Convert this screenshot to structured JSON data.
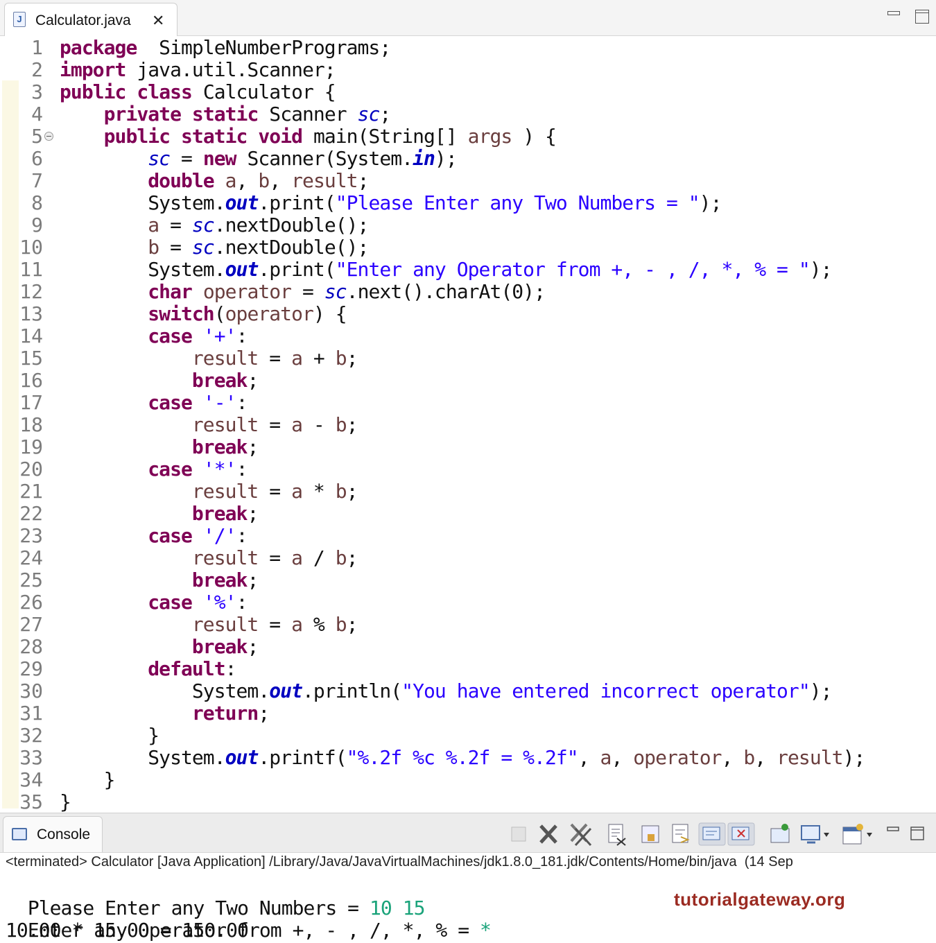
{
  "editor": {
    "tab_title": "Calculator.java",
    "tab_close": "✕"
  },
  "console": {
    "tab_title": "Console",
    "status": "<terminated> Calculator [Java Application] /Library/Java/JavaVirtualMachines/jdk1.8.0_181.jdk/Contents/Home/bin/java  (14 Sep",
    "output": {
      "line1_prompt": "Please Enter any Two Numbers = ",
      "line1_input": "10 15",
      "line2_prompt": "Enter any Operator from +, - , /, *, % = ",
      "line2_input": "*",
      "line3": "10.00 * 15.00 = 150.00"
    }
  },
  "watermark": "tutorialgateway.org",
  "lines": [
    {
      "n": "1",
      "tokens": [
        [
          "k",
          "package"
        ],
        [
          "",
          "  SimpleNumberPrograms;"
        ]
      ]
    },
    {
      "n": "2",
      "tokens": [
        [
          "k",
          "import"
        ],
        [
          "",
          " java.util.Scanner;"
        ]
      ]
    },
    {
      "n": "3",
      "tokens": [
        [
          "k",
          "public"
        ],
        [
          "",
          " "
        ],
        [
          "k",
          "class"
        ],
        [
          "",
          " Calculator {"
        ]
      ]
    },
    {
      "n": "4",
      "tokens": [
        [
          "",
          "    "
        ],
        [
          "k",
          "private"
        ],
        [
          "",
          " "
        ],
        [
          "k",
          "static"
        ],
        [
          "",
          " Scanner "
        ],
        [
          "f",
          "sc"
        ],
        [
          "",
          ";"
        ]
      ]
    },
    {
      "n": "5",
      "fold": true,
      "tokens": [
        [
          "",
          "    "
        ],
        [
          "k",
          "public"
        ],
        [
          "",
          " "
        ],
        [
          "k",
          "static"
        ],
        [
          "",
          " "
        ],
        [
          "k",
          "void"
        ],
        [
          "",
          " main(String[] "
        ],
        [
          "v",
          "args"
        ],
        [
          "",
          " ) {"
        ]
      ]
    },
    {
      "n": "6",
      "tokens": [
        [
          "",
          "        "
        ],
        [
          "f",
          "sc"
        ],
        [
          "",
          " = "
        ],
        [
          "k",
          "new"
        ],
        [
          "",
          " Scanner(System."
        ],
        [
          "sf",
          "in"
        ],
        [
          "",
          ");"
        ]
      ]
    },
    {
      "n": "7",
      "tokens": [
        [
          "",
          "        "
        ],
        [
          "k",
          "double"
        ],
        [
          "",
          " "
        ],
        [
          "v",
          "a"
        ],
        [
          "",
          ", "
        ],
        [
          "v",
          "b"
        ],
        [
          "",
          ", "
        ],
        [
          "v",
          "result"
        ],
        [
          "",
          ";"
        ]
      ]
    },
    {
      "n": "8",
      "tokens": [
        [
          "",
          "        System."
        ],
        [
          "sf",
          "out"
        ],
        [
          "",
          ".print("
        ],
        [
          "s",
          "\"Please Enter any Two Numbers = \""
        ],
        [
          "",
          ");"
        ]
      ]
    },
    {
      "n": "9",
      "tokens": [
        [
          "",
          "        "
        ],
        [
          "v",
          "a"
        ],
        [
          "",
          " = "
        ],
        [
          "f",
          "sc"
        ],
        [
          "",
          ".nextDouble();"
        ]
      ]
    },
    {
      "n": "10",
      "tokens": [
        [
          "",
          "        "
        ],
        [
          "v",
          "b"
        ],
        [
          "",
          " = "
        ],
        [
          "f",
          "sc"
        ],
        [
          "",
          ".nextDouble();"
        ]
      ]
    },
    {
      "n": "11",
      "tokens": [
        [
          "",
          "        System."
        ],
        [
          "sf",
          "out"
        ],
        [
          "",
          ".print("
        ],
        [
          "s",
          "\"Enter any Operator from +, - , /, *, % = \""
        ],
        [
          "",
          ");"
        ]
      ]
    },
    {
      "n": "12",
      "tokens": [
        [
          "",
          "        "
        ],
        [
          "k",
          "char"
        ],
        [
          "",
          " "
        ],
        [
          "v",
          "operator"
        ],
        [
          "",
          " = "
        ],
        [
          "f",
          "sc"
        ],
        [
          "",
          ".next().charAt(0);"
        ]
      ]
    },
    {
      "n": "13",
      "tokens": [
        [
          "",
          "        "
        ],
        [
          "k",
          "switch"
        ],
        [
          "",
          "("
        ],
        [
          "v",
          "operator"
        ],
        [
          "",
          ") {"
        ]
      ]
    },
    {
      "n": "14",
      "tokens": [
        [
          "",
          "        "
        ],
        [
          "k",
          "case"
        ],
        [
          "",
          " "
        ],
        [
          "s",
          "'+'"
        ],
        [
          "",
          ":"
        ]
      ]
    },
    {
      "n": "15",
      "tokens": [
        [
          "",
          "            "
        ],
        [
          "v",
          "result"
        ],
        [
          "",
          " = "
        ],
        [
          "v",
          "a"
        ],
        [
          "",
          " + "
        ],
        [
          "v",
          "b"
        ],
        [
          "",
          ";"
        ]
      ]
    },
    {
      "n": "16",
      "tokens": [
        [
          "",
          "            "
        ],
        [
          "k",
          "break"
        ],
        [
          "",
          ";"
        ]
      ]
    },
    {
      "n": "17",
      "tokens": [
        [
          "",
          "        "
        ],
        [
          "k",
          "case"
        ],
        [
          "",
          " "
        ],
        [
          "s",
          "'-'"
        ],
        [
          "",
          ":"
        ]
      ]
    },
    {
      "n": "18",
      "tokens": [
        [
          "",
          "            "
        ],
        [
          "v",
          "result"
        ],
        [
          "",
          " = "
        ],
        [
          "v",
          "a"
        ],
        [
          "",
          " - "
        ],
        [
          "v",
          "b"
        ],
        [
          "",
          ";"
        ]
      ]
    },
    {
      "n": "19",
      "tokens": [
        [
          "",
          "            "
        ],
        [
          "k",
          "break"
        ],
        [
          "",
          ";"
        ]
      ]
    },
    {
      "n": "20",
      "tokens": [
        [
          "",
          "        "
        ],
        [
          "k",
          "case"
        ],
        [
          "",
          " "
        ],
        [
          "s",
          "'*'"
        ],
        [
          "",
          ":"
        ]
      ]
    },
    {
      "n": "21",
      "tokens": [
        [
          "",
          "            "
        ],
        [
          "v",
          "result"
        ],
        [
          "",
          " = "
        ],
        [
          "v",
          "a"
        ],
        [
          "",
          " * "
        ],
        [
          "v",
          "b"
        ],
        [
          "",
          ";"
        ]
      ]
    },
    {
      "n": "22",
      "tokens": [
        [
          "",
          "            "
        ],
        [
          "k",
          "break"
        ],
        [
          "",
          ";"
        ]
      ]
    },
    {
      "n": "23",
      "tokens": [
        [
          "",
          "        "
        ],
        [
          "k",
          "case"
        ],
        [
          "",
          " "
        ],
        [
          "s",
          "'/'"
        ],
        [
          "",
          ":"
        ]
      ]
    },
    {
      "n": "24",
      "tokens": [
        [
          "",
          "            "
        ],
        [
          "v",
          "result"
        ],
        [
          "",
          " = "
        ],
        [
          "v",
          "a"
        ],
        [
          "",
          " / "
        ],
        [
          "v",
          "b"
        ],
        [
          "",
          ";"
        ]
      ]
    },
    {
      "n": "25",
      "tokens": [
        [
          "",
          "            "
        ],
        [
          "k",
          "break"
        ],
        [
          "",
          ";"
        ]
      ]
    },
    {
      "n": "26",
      "tokens": [
        [
          "",
          "        "
        ],
        [
          "k",
          "case"
        ],
        [
          "",
          " "
        ],
        [
          "s",
          "'%'"
        ],
        [
          "",
          ":"
        ]
      ]
    },
    {
      "n": "27",
      "tokens": [
        [
          "",
          "            "
        ],
        [
          "v",
          "result"
        ],
        [
          "",
          " = "
        ],
        [
          "v",
          "a"
        ],
        [
          "",
          " % "
        ],
        [
          "v",
          "b"
        ],
        [
          "",
          ";"
        ]
      ]
    },
    {
      "n": "28",
      "tokens": [
        [
          "",
          "            "
        ],
        [
          "k",
          "break"
        ],
        [
          "",
          ";"
        ]
      ]
    },
    {
      "n": "29",
      "tokens": [
        [
          "",
          "        "
        ],
        [
          "k",
          "default"
        ],
        [
          "",
          ":"
        ]
      ]
    },
    {
      "n": "30",
      "tokens": [
        [
          "",
          "            System."
        ],
        [
          "sf",
          "out"
        ],
        [
          "",
          ".println("
        ],
        [
          "s",
          "\"You have entered incorrect operator\""
        ],
        [
          "",
          ");"
        ]
      ]
    },
    {
      "n": "31",
      "tokens": [
        [
          "",
          "            "
        ],
        [
          "k",
          "return"
        ],
        [
          "",
          ";"
        ]
      ]
    },
    {
      "n": "32",
      "tokens": [
        [
          "",
          "        }"
        ]
      ]
    },
    {
      "n": "33",
      "tokens": [
        [
          "",
          "        System."
        ],
        [
          "sf",
          "out"
        ],
        [
          "",
          ".printf("
        ],
        [
          "s",
          "\"%.2f %c %.2f = %.2f\""
        ],
        [
          "",
          ", "
        ],
        [
          "v",
          "a"
        ],
        [
          "",
          ", "
        ],
        [
          "v",
          "operator"
        ],
        [
          "",
          ", "
        ],
        [
          "v",
          "b"
        ],
        [
          "",
          ", "
        ],
        [
          "v",
          "result"
        ],
        [
          "",
          ");"
        ]
      ]
    },
    {
      "n": "34",
      "tokens": [
        [
          "",
          "    }"
        ]
      ]
    },
    {
      "n": "35",
      "tokens": [
        [
          "",
          "}"
        ]
      ]
    }
  ]
}
